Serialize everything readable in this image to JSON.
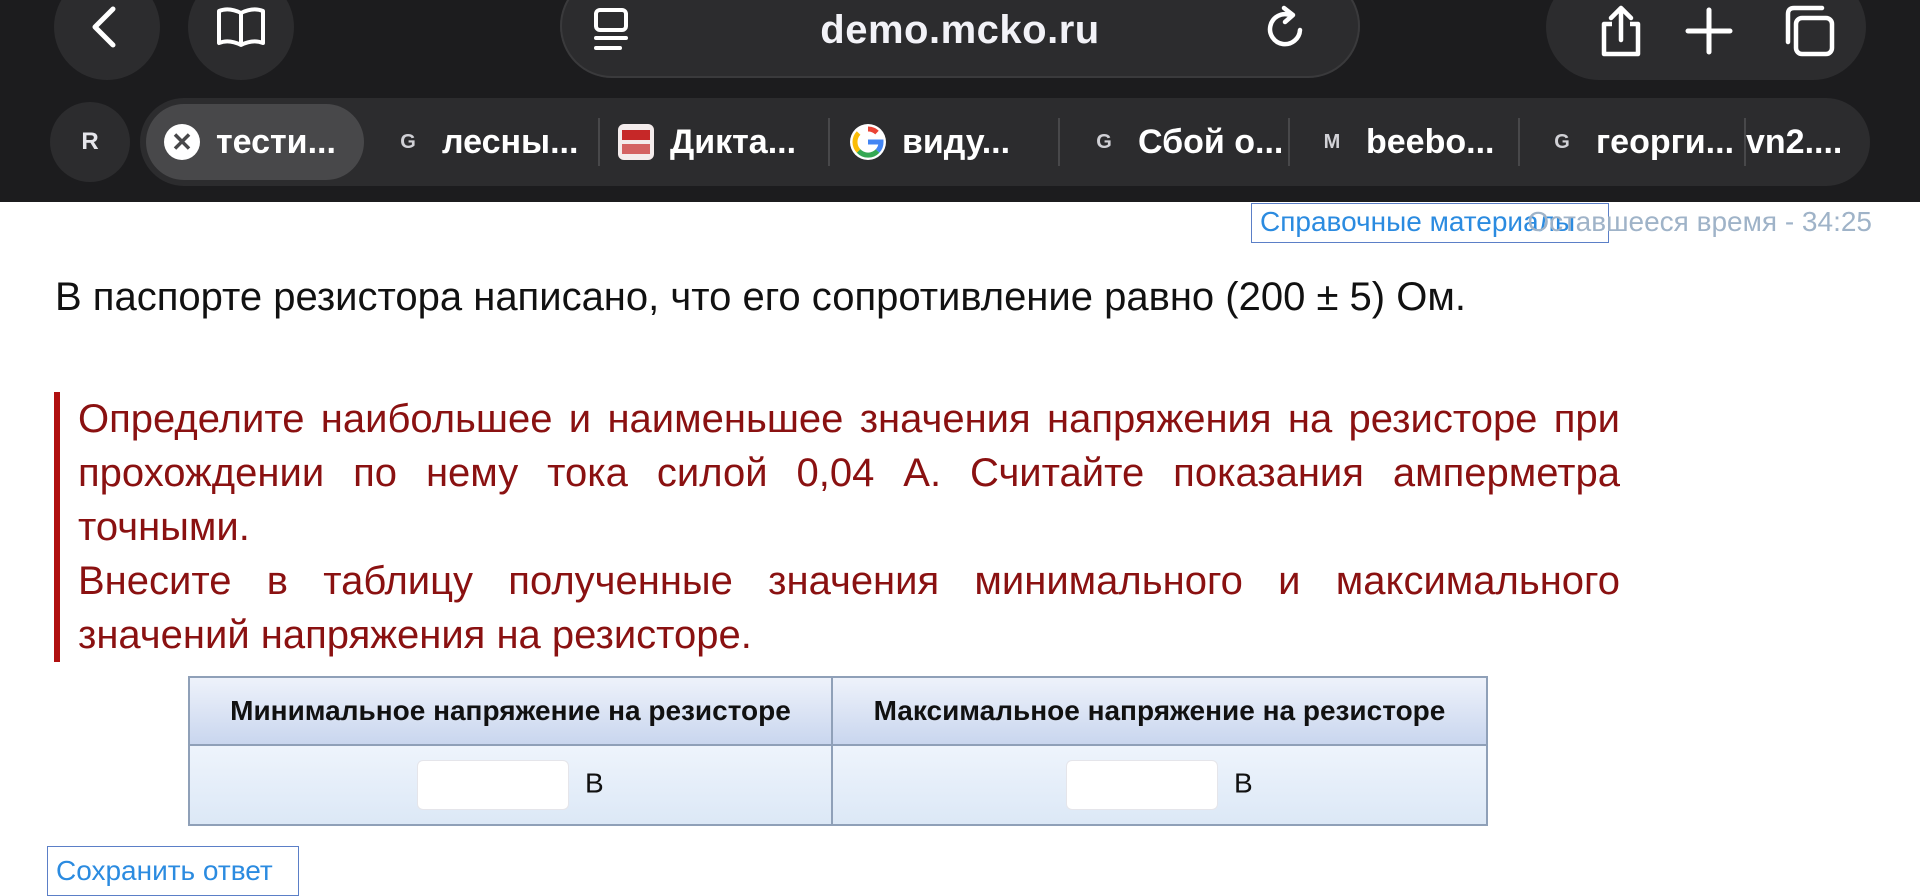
{
  "browser": {
    "url": "demo.mcko.ru",
    "profile_initial": "R",
    "tabs": [
      {
        "favicon": "close-icon",
        "favicon_text": "✕",
        "title": "тести...",
        "active": true
      },
      {
        "favicon": "g-letter-icon",
        "favicon_text": "G",
        "title": "лесны..."
      },
      {
        "favicon": "diktant-icon",
        "favicon_text": "",
        "title": "Дикта..."
      },
      {
        "favicon": "google-icon",
        "favicon_text": "G",
        "title": "виду..."
      },
      {
        "favicon": "g-letter-icon",
        "favicon_text": "G",
        "title": "Сбой о..."
      },
      {
        "favicon": "m-letter-icon",
        "favicon_text": "M",
        "title": "beebo..."
      },
      {
        "favicon": "g-letter-icon",
        "favicon_text": "G",
        "title": "георги..."
      },
      {
        "favicon": "",
        "favicon_text": "",
        "title": "vn2...."
      }
    ]
  },
  "page": {
    "reference_link": "Справочные материалы",
    "timer": "Оставшееся время - 34:25",
    "intro": "В паспорте резистора написано, что его сопротивление равно (200 ± 5) Ом.",
    "task_line_1": "Определите наибольшее и наименьшее значения напряжения на резисторе при прохождении по нему тока силой 0,04 А. Считайте показания амперметра точными.",
    "task_line_2": "Внесите в таблицу полученные значения минимального и максимального значений напряжения на резисторе.",
    "table": {
      "headers": [
        "Минимальное напряжение на резисторе",
        "Максимальное напряжение на резисторе"
      ],
      "min_value": "",
      "max_value": "",
      "unit": "В"
    },
    "save_button": "Сохранить ответ"
  },
  "colors": {
    "chrome_bg": "#1c1c1e",
    "task_text": "#8a1111",
    "task_border": "#b01010",
    "link": "#2b8be0"
  }
}
